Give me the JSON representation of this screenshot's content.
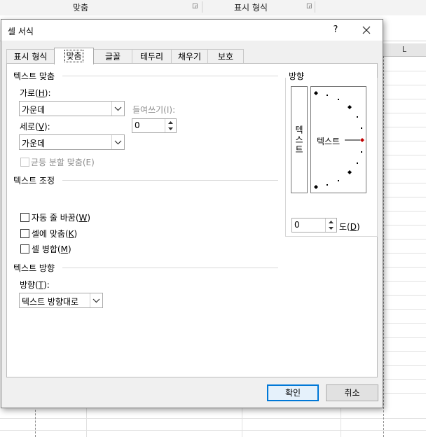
{
  "ribbon": {
    "group1": "맞춤",
    "group2": "표시 형식"
  },
  "sheet": {
    "column_L": "L"
  },
  "dialog": {
    "title": "셀 서식",
    "help": "?",
    "tabs": [
      {
        "label": "표시 형식"
      },
      {
        "label": "맞춤"
      },
      {
        "label": "글꼴"
      },
      {
        "label": "테두리"
      },
      {
        "label": "채우기"
      },
      {
        "label": "보호"
      }
    ],
    "active_tab": "맞춤",
    "text_alignment": {
      "section": "텍스트 맞춤",
      "horizontal_label": "가로(",
      "horizontal_key": "H",
      "horizontal_value": "가운데",
      "indent_label": "들여쓰기(I):",
      "indent_value": "0",
      "vertical_label": "세로(",
      "vertical_key": "V",
      "vertical_value": "가운데",
      "justify_distributed": "균등 분할 맞춤(E)"
    },
    "text_control": {
      "section": "텍스트 조정",
      "wrap_text": "자동 줄 바꿈(",
      "wrap_key": "W",
      "shrink": "셀에 맞춤(",
      "shrink_key": "K",
      "merge": "셀 병합(",
      "merge_key": "M",
      "wrap_checked": false,
      "shrink_checked": false,
      "merge_checked": false
    },
    "rtl": {
      "section": "텍스트 방향",
      "direction_label": "방향(",
      "direction_key": "T",
      "direction_value": "텍스트 방향대로"
    },
    "orientation": {
      "section": "방향",
      "vertical_text": "텍스트",
      "dial_text": "텍스트",
      "degrees_value": "0",
      "degrees_label": "도(",
      "degrees_key": "D",
      "accent_color": "#c00000"
    },
    "buttons": {
      "ok": "확인",
      "cancel": "취소"
    }
  }
}
